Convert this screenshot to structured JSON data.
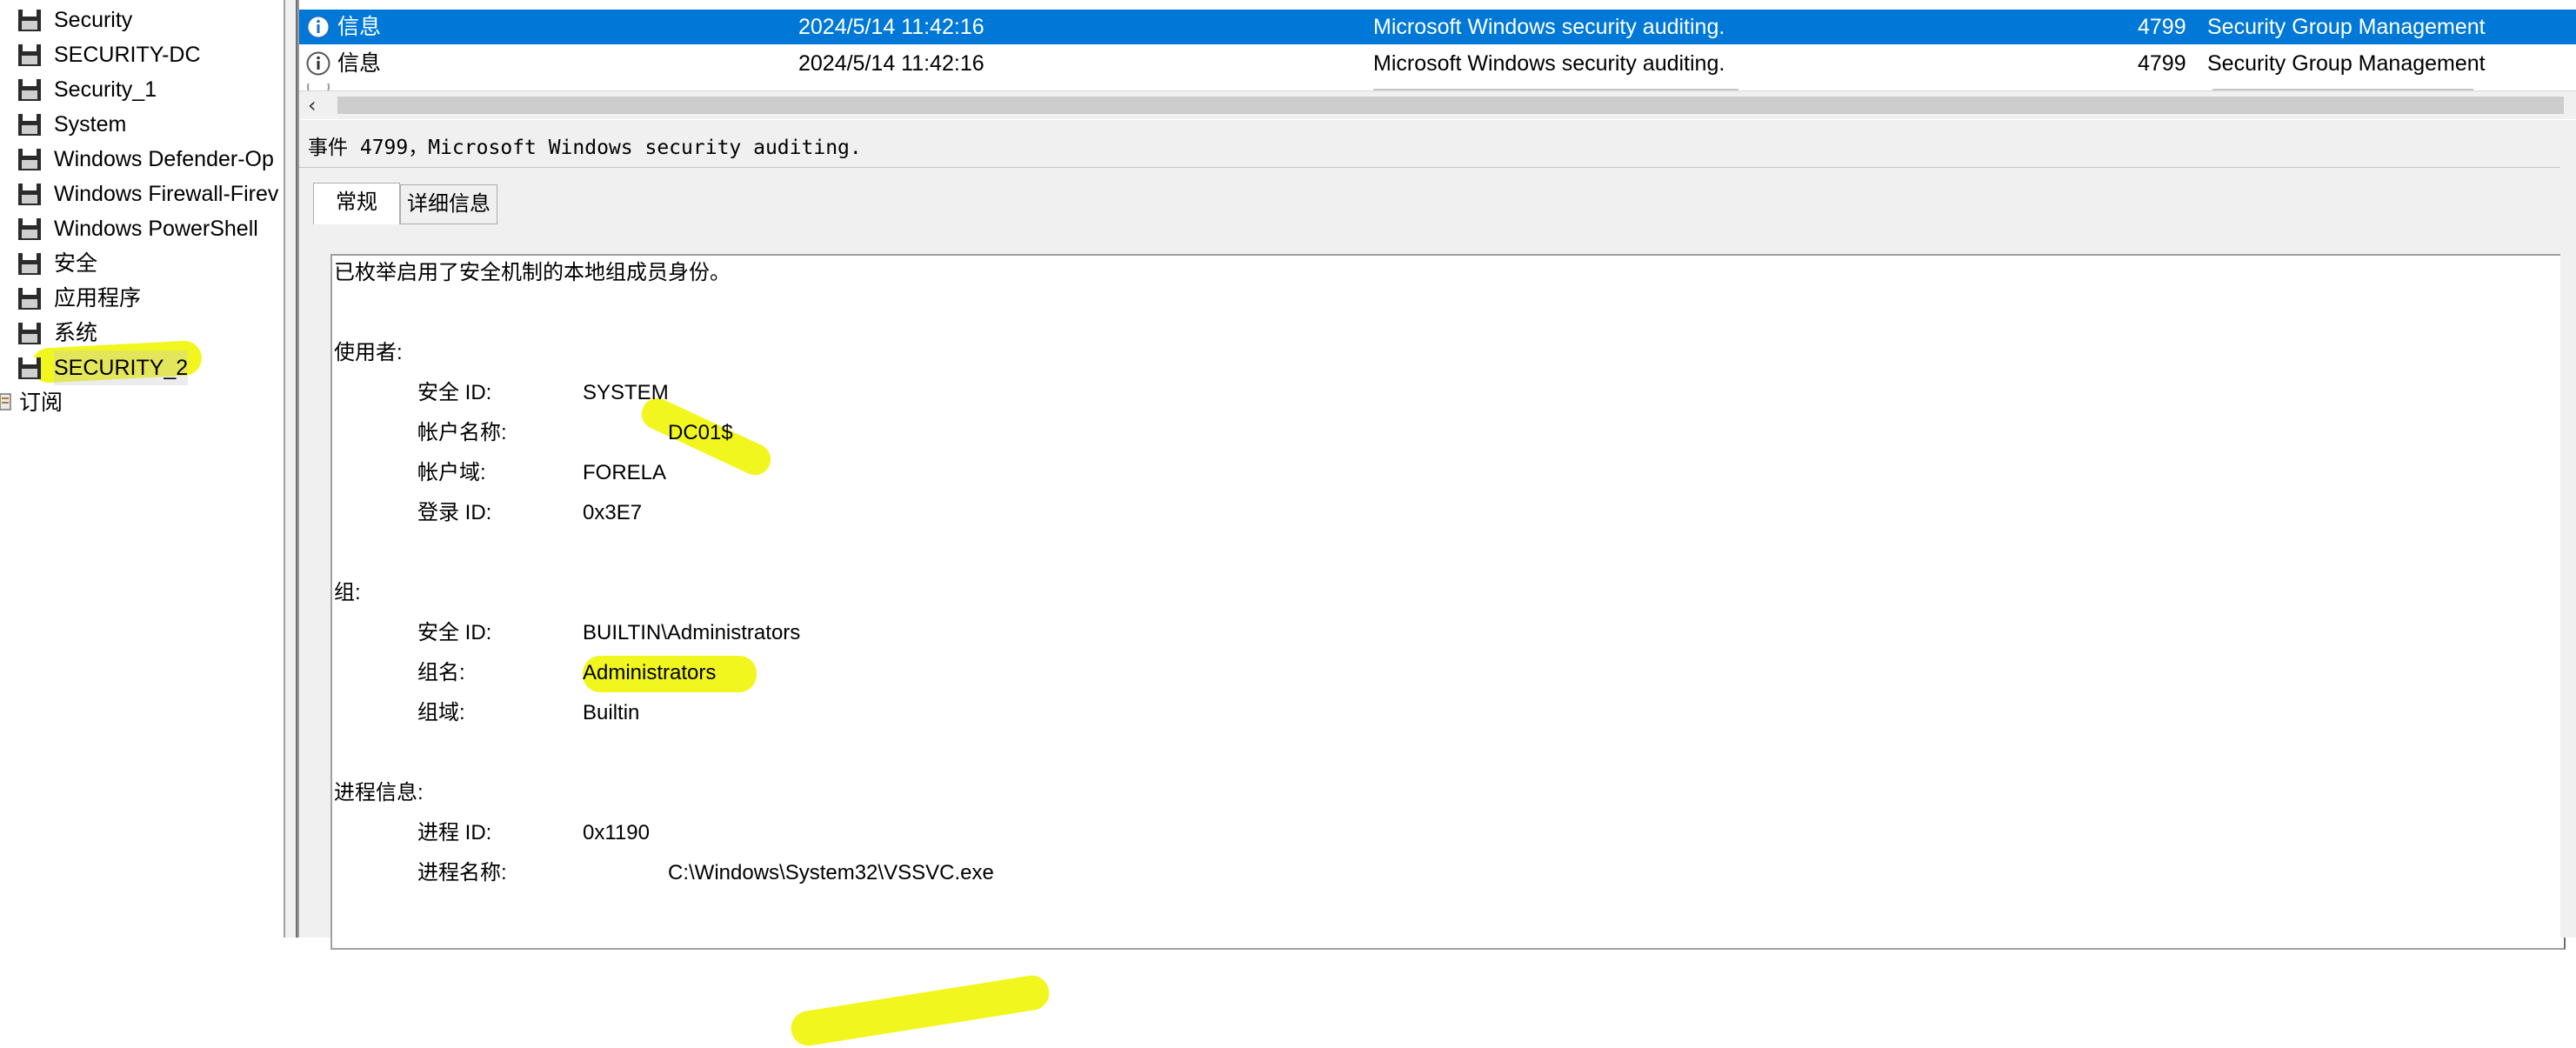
{
  "tree": {
    "items": [
      {
        "label": "Security"
      },
      {
        "label": "SECURITY-DC"
      },
      {
        "label": "Security_1"
      },
      {
        "label": "System"
      },
      {
        "label": "Windows Defender-Op"
      },
      {
        "label": "Windows Firewall-Firev"
      },
      {
        "label": "Windows PowerShell"
      },
      {
        "label": "安全"
      },
      {
        "label": "应用程序"
      },
      {
        "label": "系统"
      },
      {
        "label": "SECURITY_2"
      }
    ],
    "subscriptions_label": "订阅"
  },
  "events": {
    "rows": [
      {
        "level": "信息",
        "date": "2024/5/14 11:42:16",
        "source": "Microsoft Windows security auditing.",
        "event_id": "4799",
        "task": "Security Group Management",
        "selected": true
      },
      {
        "level": "信息",
        "date": "2024/5/14 11:42:16",
        "source": "Microsoft Windows security auditing.",
        "event_id": "4799",
        "task": "Security Group Management",
        "selected": false
      }
    ]
  },
  "details": {
    "header": "事件 4799，Microsoft Windows security auditing.",
    "tabs": [
      {
        "label": "常规",
        "active": true
      },
      {
        "label": "详细信息",
        "active": false
      }
    ],
    "description": "已枚举启用了安全机制的本地组成员身份。",
    "subject": {
      "heading": "使用者:",
      "security_id_label": "安全 ID:",
      "security_id": "SYSTEM",
      "account_name_label": "帐户名称:",
      "account_name": "DC01$",
      "account_domain_label": "帐户域:",
      "account_domain": "FORELA",
      "logon_id_label": "登录 ID:",
      "logon_id": "0x3E7"
    },
    "group": {
      "heading": "组:",
      "security_id_label": "安全 ID:",
      "security_id": "BUILTIN\\Administrators",
      "group_name_label": "组名:",
      "group_name": "Administrators",
      "group_domain_label": "组域:",
      "group_domain": "Builtin"
    },
    "process": {
      "heading": "进程信息:",
      "process_id_label": "进程 ID:",
      "process_id": "0x1190",
      "process_name_label": "进程名称:",
      "process_name": "C:\\Windows\\System32\\VSSVC.exe"
    }
  },
  "colors": {
    "selection": "#0078d7",
    "highlighter": "#f0f500",
    "info_icon": "#1f6fc5"
  },
  "icons": {
    "log": "event-log-icon",
    "info": "info-icon",
    "subscription": "subscription-icon"
  }
}
